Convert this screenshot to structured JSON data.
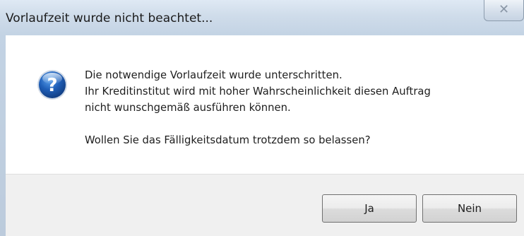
{
  "window": {
    "title": "Vorlaufzeit wurde nicht beachtet...",
    "close_glyph": "✕"
  },
  "dialog": {
    "icon": "question-icon",
    "message_lines": [
      "Die notwendige Vorlaufzeit wurde unterschritten.",
      "Ihr Kreditinstitut wird mit hoher Wahrscheinlichkeit diesen Auftrag",
      "nicht wunschgemäß ausführen können."
    ],
    "question": "Wollen Sie das Fälligkeitsdatum trotzdem so belassen?"
  },
  "buttons": {
    "yes_label": "Ja",
    "no_label": "Nein"
  },
  "colors": {
    "titlebar": "#cfdcea",
    "icon_blue": "#1f5fb8",
    "footer": "#f0f0f0"
  }
}
